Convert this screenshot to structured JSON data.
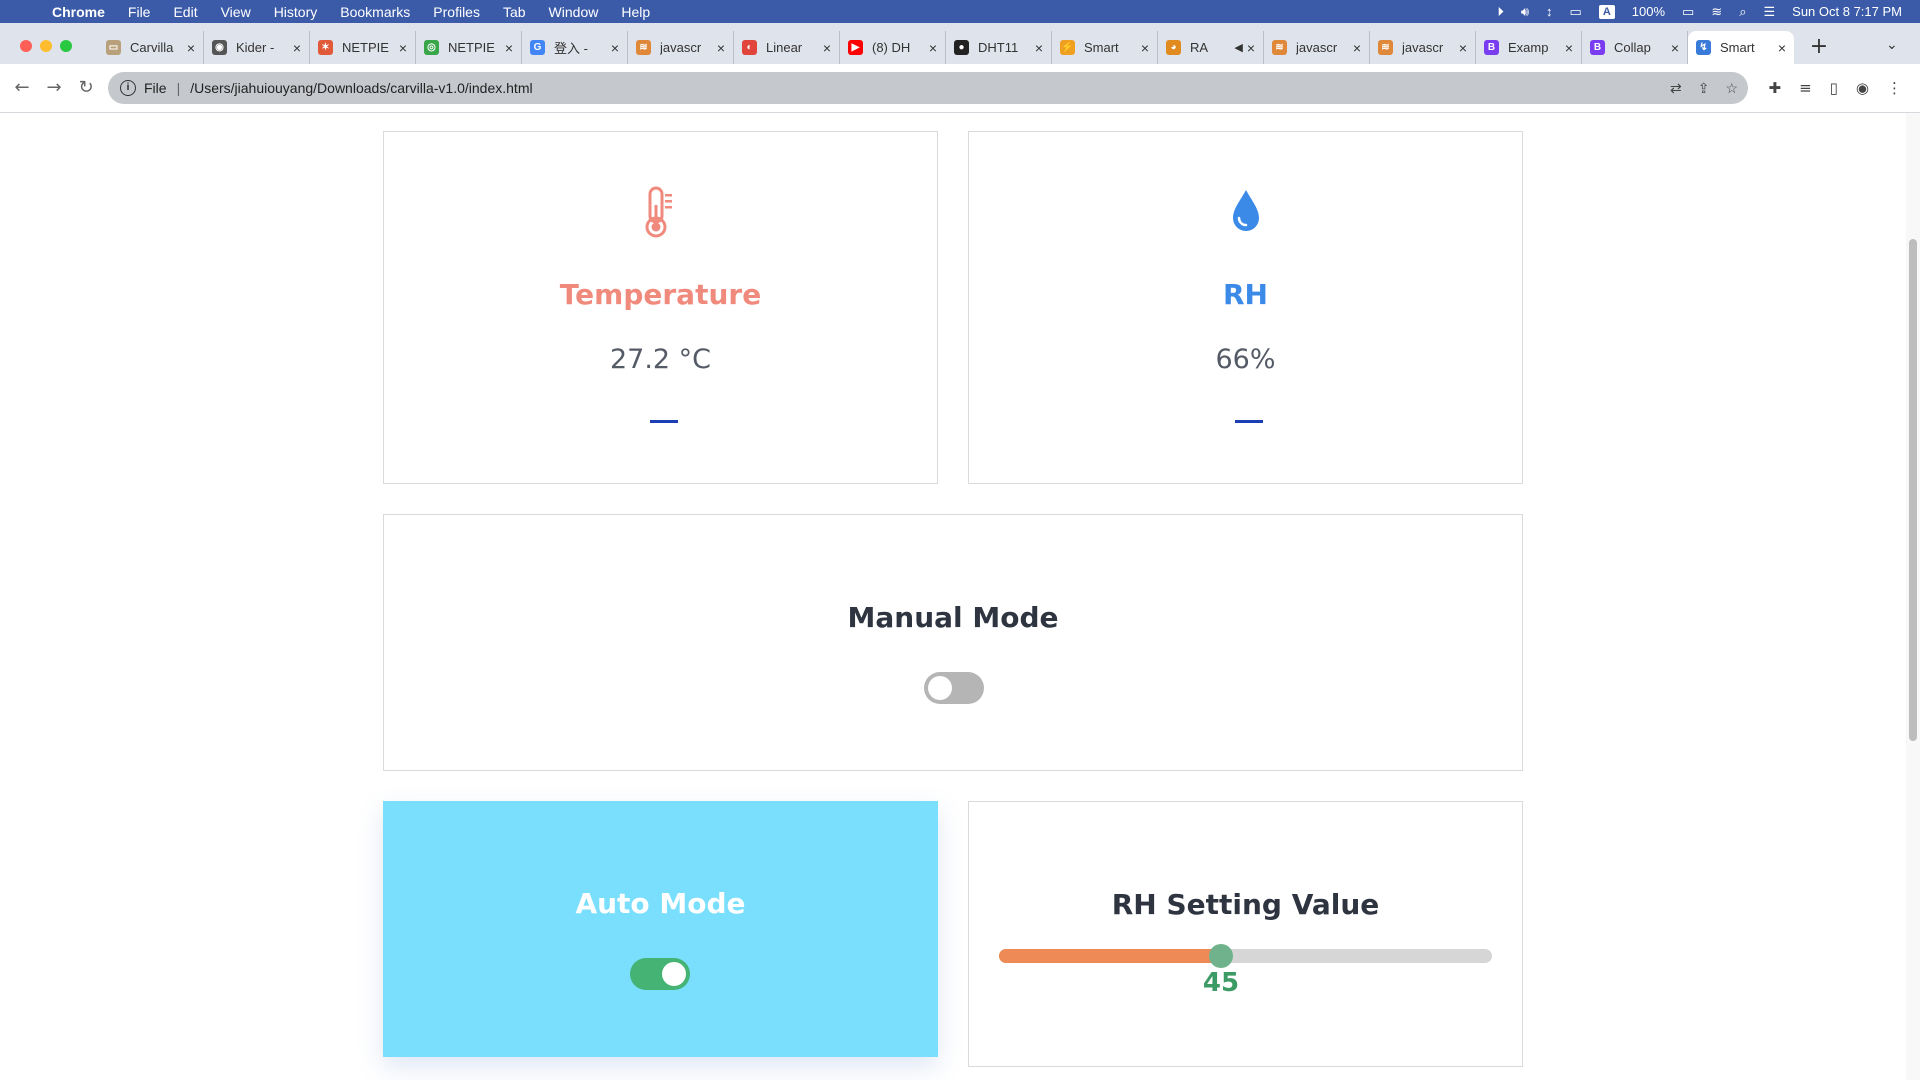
{
  "menubar": {
    "app": "Chrome",
    "items": [
      "File",
      "Edit",
      "View",
      "History",
      "Bookmarks",
      "Profiles",
      "Tab",
      "Window",
      "Help"
    ],
    "keyboard_badge": "A",
    "battery": "100%",
    "datetime": "Sun Oct 8  7:17 PM"
  },
  "tabs": [
    {
      "title": "Carvilla",
      "favicon_color": "#b8a07a",
      "favicon_glyph": "▭"
    },
    {
      "title": "Kider -",
      "favicon_color": "#555555",
      "favicon_glyph": "◉"
    },
    {
      "title": "NETPIE",
      "favicon_color": "#e05a3a",
      "favicon_glyph": "✶"
    },
    {
      "title": "NETPIE",
      "favicon_color": "#3aa64a",
      "favicon_glyph": "◎"
    },
    {
      "title": "登入 -",
      "favicon_color": "#4285f4",
      "favicon_glyph": "G"
    },
    {
      "title": "javascr",
      "favicon_color": "#e0883a",
      "favicon_glyph": "≋"
    },
    {
      "title": "Linear",
      "favicon_color": "#e0443a",
      "favicon_glyph": "◐"
    },
    {
      "title": "(8) DH",
      "favicon_color": "#ff0000",
      "favicon_glyph": "▶"
    },
    {
      "title": "DHT11",
      "favicon_color": "#222222",
      "favicon_glyph": "●"
    },
    {
      "title": "Smart",
      "favicon_color": "#f0a020",
      "favicon_glyph": "⚡"
    },
    {
      "title": "RA",
      "favicon_color": "#e08a20",
      "favicon_glyph": "◕",
      "muted": true
    },
    {
      "title": "javascr",
      "favicon_color": "#e0883a",
      "favicon_glyph": "≋"
    },
    {
      "title": "javascr",
      "favicon_color": "#e0883a",
      "favicon_glyph": "≋"
    },
    {
      "title": "Examp",
      "favicon_color": "#7a3cf0",
      "favicon_glyph": "B"
    },
    {
      "title": "Collap",
      "favicon_color": "#7a3cf0",
      "favicon_glyph": "B"
    },
    {
      "title": "Smart",
      "favicon_color": "#3a7ad8",
      "favicon_glyph": "↯",
      "active": true
    }
  ],
  "address": {
    "scheme_label": "File",
    "path": "/Users/jiahuiouyang/Downloads/carvilla-v1.0/index.html"
  },
  "dashboard": {
    "temperature": {
      "title": "Temperature",
      "value": "27.2 °C",
      "color": "#f08a7c",
      "icon": "thermometer-icon"
    },
    "humidity": {
      "title": "RH",
      "value": "66%",
      "color": "#3b8ae8",
      "icon": "water-drop-icon"
    },
    "manual_mode": {
      "title": "Manual Mode",
      "enabled": false
    },
    "auto_mode": {
      "title": "Auto Mode",
      "enabled": true,
      "background": "#7adffc"
    },
    "rh_setting": {
      "title": "RH Setting Value",
      "value": 45,
      "min": 0,
      "max": 100,
      "display": "45"
    }
  },
  "colors": {
    "toggle_on": "#44b374",
    "toggle_off": "#b5b5b5",
    "dark_text": "#2e3440",
    "dash": "#1c3fb5"
  }
}
